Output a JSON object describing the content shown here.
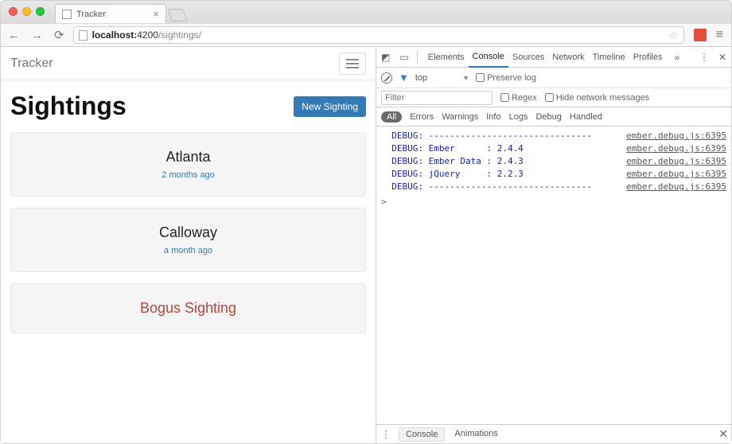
{
  "browser": {
    "tab_title": "Tracker",
    "url_host": "localhost:",
    "url_port": "4200",
    "url_path": "/sightings/"
  },
  "app": {
    "brand": "Tracker",
    "heading": "Sightings",
    "new_button": "New Sighting",
    "cards": [
      {
        "title": "Atlanta",
        "sub": "2 months ago",
        "bogus": false
      },
      {
        "title": "Calloway",
        "sub": "a month ago",
        "bogus": false
      },
      {
        "title": "Bogus Sighting",
        "sub": "",
        "bogus": true
      }
    ]
  },
  "devtools": {
    "tabs": [
      "Elements",
      "Console",
      "Sources",
      "Network",
      "Timeline",
      "Profiles"
    ],
    "active_tab": "Console",
    "context": "top",
    "preserve_label": "Preserve log",
    "filter_placeholder": "Filter",
    "regex_label": "Regex",
    "hide_label": "Hide network messages",
    "levels": [
      "All",
      "Errors",
      "Warnings",
      "Info",
      "Logs",
      "Debug",
      "Handled"
    ],
    "active_level": "All",
    "logs": [
      {
        "text": "DEBUG: -------------------------------",
        "src": "ember.debug.js:6395"
      },
      {
        "text": "DEBUG: Ember      : 2.4.4",
        "src": "ember.debug.js:6395"
      },
      {
        "text": "DEBUG: Ember Data : 2.4.3",
        "src": "ember.debug.js:6395"
      },
      {
        "text": "DEBUG: jQuery     : 2.2.3",
        "src": "ember.debug.js:6395"
      },
      {
        "text": "DEBUG: -------------------------------",
        "src": "ember.debug.js:6395"
      }
    ],
    "drawer_tabs": [
      "Console",
      "Animations"
    ]
  }
}
